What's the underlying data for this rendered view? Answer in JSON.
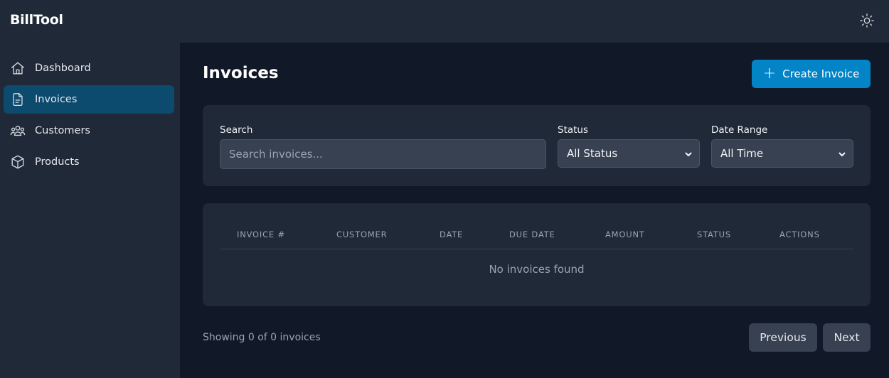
{
  "app": {
    "brand": "BillTool"
  },
  "sidebar": {
    "items": [
      {
        "label": "Dashboard",
        "icon": "home-icon",
        "active": false
      },
      {
        "label": "Invoices",
        "icon": "document-icon",
        "active": true
      },
      {
        "label": "Customers",
        "icon": "users-icon",
        "active": false
      },
      {
        "label": "Products",
        "icon": "cube-icon",
        "active": false
      }
    ]
  },
  "header": {
    "theme_icon": "sun-icon"
  },
  "main": {
    "title": "Invoices",
    "create_label": "Create Invoice",
    "filters": {
      "search_label": "Search",
      "search_placeholder": "Search invoices...",
      "search_value": "",
      "status_label": "Status",
      "status_value": "All Status",
      "date_label": "Date Range",
      "date_value": "All Time"
    },
    "table": {
      "columns": [
        "Invoice #",
        "Customer",
        "Date",
        "Due Date",
        "Amount",
        "Status",
        "Actions"
      ],
      "rows": [],
      "empty_message": "No invoices found"
    },
    "pagination": {
      "summary": "Showing 0 of 0 invoices",
      "previous_label": "Previous",
      "next_label": "Next"
    }
  },
  "colors": {
    "accent": "#0284c7",
    "sidebar_active": "#0c4a6e",
    "background": "#111827",
    "panel": "#1f2937"
  }
}
